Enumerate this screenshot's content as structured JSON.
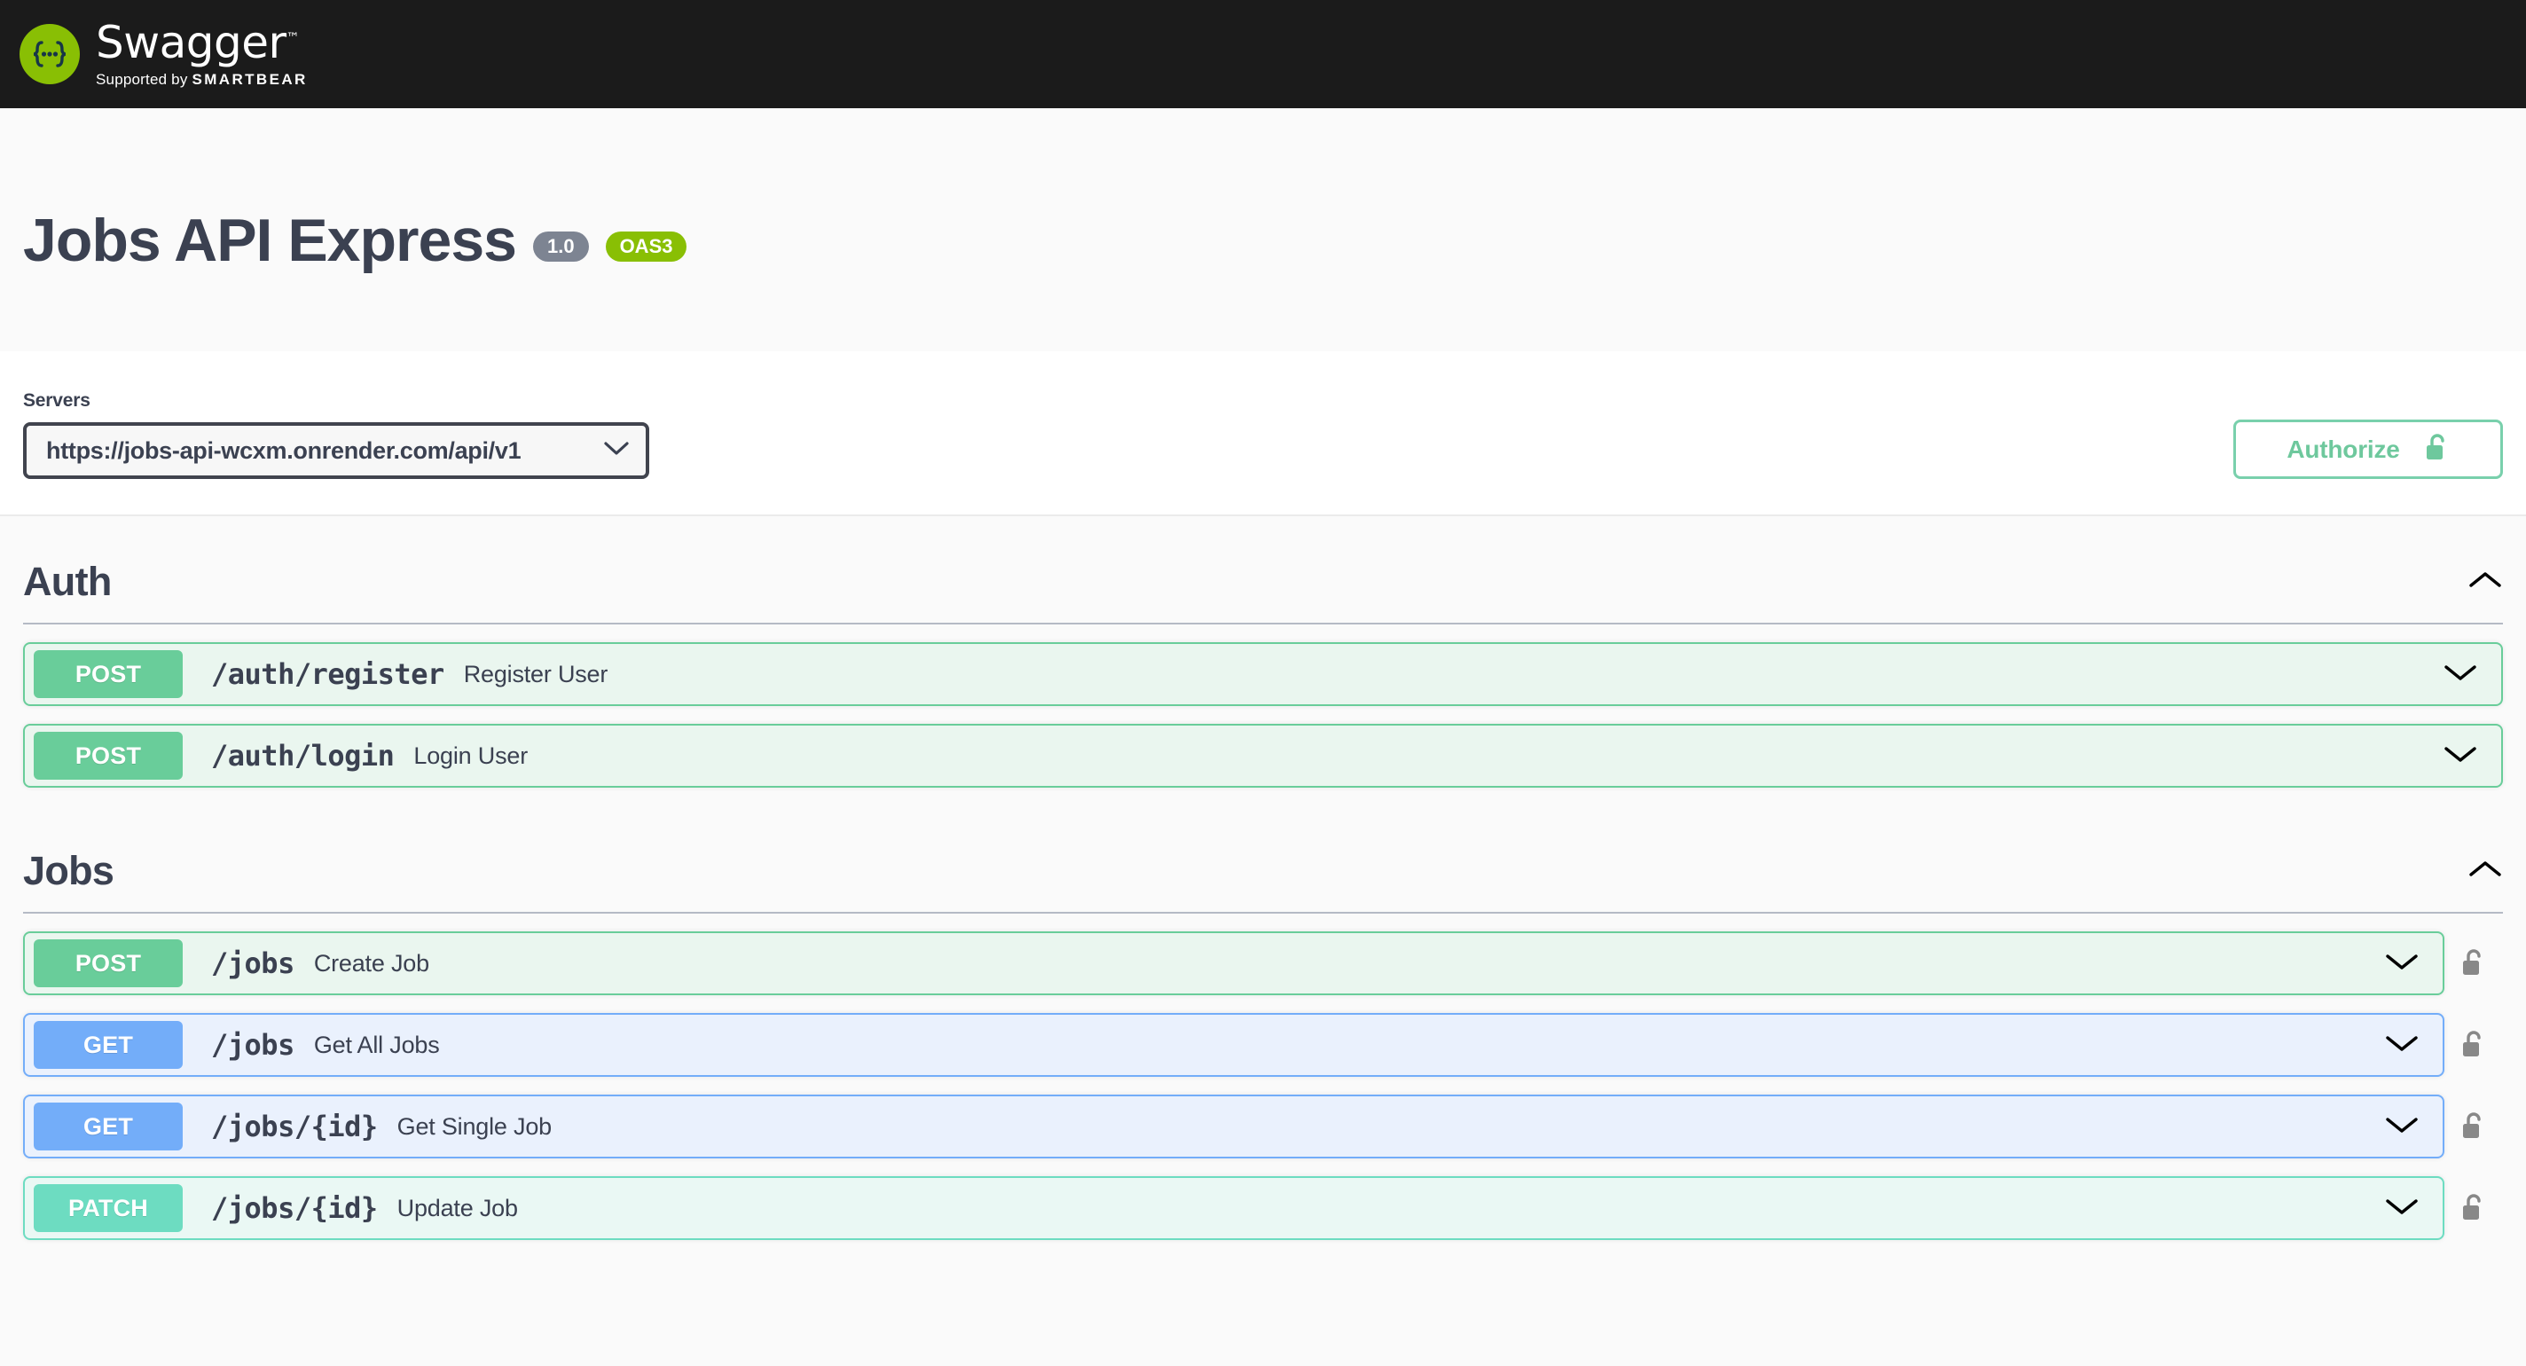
{
  "topbar": {
    "logo_word": "Swagger",
    "logo_tm": "™",
    "supported_by": "Supported by",
    "brand": "SMARTBEAR",
    "logo_icon": "swagger-braces-logo"
  },
  "info": {
    "title": "Jobs API Express",
    "version_badge": "1.0",
    "spec_badge": "OAS3"
  },
  "servers": {
    "label": "Servers",
    "selected_url": "https://jobs-api-wcxm.onrender.com/api/v1",
    "options": [
      "https://jobs-api-wcxm.onrender.com/api/v1"
    ],
    "dropdown_icon": "chevron-down-icon"
  },
  "authorize": {
    "label": "Authorize",
    "lock_icon": "unlocked-padlock-icon"
  },
  "sections": [
    {
      "name": "Auth",
      "expanded": true,
      "toggle_icon": "chevron-up-icon",
      "operations": [
        {
          "method": "POST",
          "path": "/auth/register",
          "summary": "Register User",
          "locked": false,
          "expand_icon": "chevron-down-icon"
        },
        {
          "method": "POST",
          "path": "/auth/login",
          "summary": "Login User",
          "locked": false,
          "expand_icon": "chevron-down-icon"
        }
      ]
    },
    {
      "name": "Jobs",
      "expanded": true,
      "toggle_icon": "chevron-up-icon",
      "operations": [
        {
          "method": "POST",
          "path": "/jobs",
          "summary": "Create Job",
          "locked": true,
          "expand_icon": "chevron-down-icon",
          "lock_icon": "unlocked-padlock-icon"
        },
        {
          "method": "GET",
          "path": "/jobs",
          "summary": "Get All Jobs",
          "locked": true,
          "expand_icon": "chevron-down-icon",
          "lock_icon": "unlocked-padlock-icon"
        },
        {
          "method": "GET",
          "path": "/jobs/{id}",
          "summary": "Get Single Job",
          "locked": true,
          "expand_icon": "chevron-down-icon",
          "lock_icon": "unlocked-padlock-icon"
        },
        {
          "method": "PATCH",
          "path": "/jobs/{id}",
          "summary": "Update Job",
          "locked": true,
          "expand_icon": "chevron-down-icon",
          "lock_icon": "unlocked-padlock-icon"
        }
      ]
    }
  ],
  "colors": {
    "topbar_bg": "#1b1b1b",
    "accent_green": "#89bf04",
    "text_dark": "#3b4151",
    "post": "#69cd9a",
    "get": "#73adf9",
    "patch": "#6ddcc1",
    "version_badge": "#7d8492",
    "authorize_green": "#6ec89d"
  }
}
